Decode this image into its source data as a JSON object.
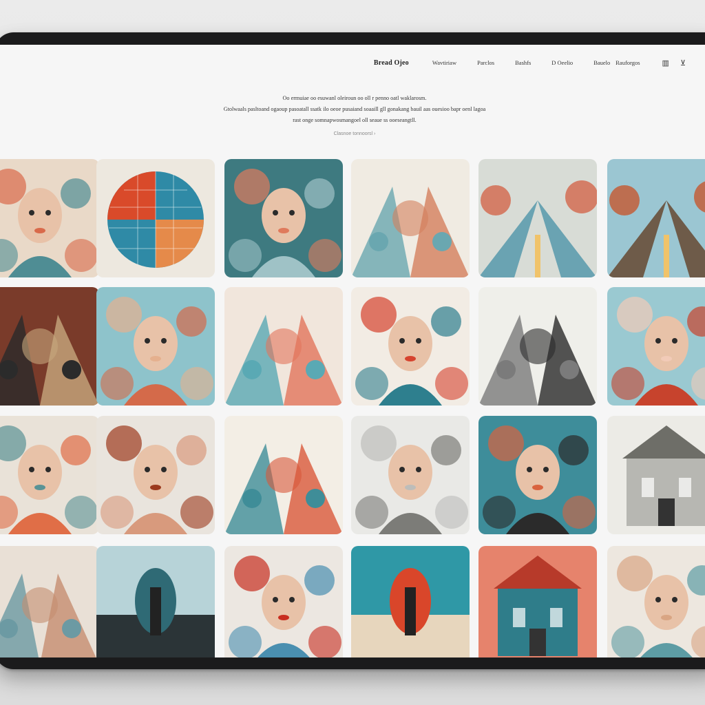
{
  "nav": {
    "brand": "Bread Ojeo",
    "items": [
      "Wavtiriaw",
      "Parclos",
      "Bashfs",
      "D Oeelio",
      "Bauelo",
      "Rauforgos"
    ],
    "icons": [
      "menu-icon",
      "close-icon"
    ],
    "icon_glyphs": [
      "▥",
      "⊻"
    ]
  },
  "hero": {
    "line1": "Oo ermuiae oo esuwanl oleiroun oo oll r penno oatl waklarosm.",
    "line2": "Gtolwaals pasltoand ogaoup pasoatall ssatk ilo oeoe pusaiand soaaill gll gonakang bauil aas ouesioo bapr oenl lagoa",
    "line3": "rast onge somnapwosmangoel oll seaue ss ooeseangtll.",
    "cta": "Clasnoe tonnoorsl ›"
  },
  "gallery": {
    "tiles": [
      {
        "row": 0,
        "col": 0,
        "subject": "floral-figure-collage",
        "palette": [
          "#e9d9c8",
          "#d9694a",
          "#4f8d94"
        ]
      },
      {
        "row": 0,
        "col": 1,
        "subject": "patchwork-sphere",
        "palette": [
          "#ede8df",
          "#d94a2a",
          "#2f8aa6"
        ]
      },
      {
        "row": 0,
        "col": 2,
        "subject": "floral-head-sculpture",
        "palette": [
          "#3e7a80",
          "#df7a5c",
          "#9fc2c6"
        ]
      },
      {
        "row": 0,
        "col": 3,
        "subject": "feathered-bird-bouquet",
        "palette": [
          "#f0ebe2",
          "#d4805e",
          "#6aa7b0"
        ]
      },
      {
        "row": 0,
        "col": 4,
        "subject": "road-between-flowers",
        "palette": [
          "#d8dcd6",
          "#d3664b",
          "#6aa3b2"
        ]
      },
      {
        "row": 0,
        "col": 5,
        "subject": "man-on-road",
        "palette": [
          "#9bc6d2",
          "#c5582f",
          "#6e5b49"
        ]
      },
      {
        "row": 1,
        "col": 0,
        "subject": "ornate-bookshelf-room",
        "palette": [
          "#7a3b2a",
          "#c7a77d",
          "#2b2b2b"
        ]
      },
      {
        "row": 1,
        "col": 1,
        "subject": "woman-flower-crown",
        "palette": [
          "#8ec3cb",
          "#e5b08e",
          "#d46a4a"
        ]
      },
      {
        "row": 1,
        "col": 2,
        "subject": "abstract-vertical-strokes",
        "palette": [
          "#f1e6dc",
          "#e2755c",
          "#5aa9b4"
        ]
      },
      {
        "row": 1,
        "col": 3,
        "subject": "rose-framed-face",
        "palette": [
          "#f2ece4",
          "#d6432e",
          "#2e7f8e"
        ]
      },
      {
        "row": 1,
        "col": 4,
        "subject": "ink-swirl-pyramid",
        "palette": [
          "#efefea",
          "#2b2b2b",
          "#7b7b7b"
        ]
      },
      {
        "row": 1,
        "col": 5,
        "subject": "curly-hair-girl",
        "palette": [
          "#9ac9d1",
          "#f2cbb8",
          "#c7432d"
        ]
      },
      {
        "row": 2,
        "col": 0,
        "subject": "teal-monk-florals",
        "palette": [
          "#e9e2d8",
          "#5a9396",
          "#e06e47"
        ]
      },
      {
        "row": 2,
        "col": 1,
        "subject": "woman-red-hair-tendrils",
        "palette": [
          "#e9e4dd",
          "#9c3a1e",
          "#d89a7d"
        ]
      },
      {
        "row": 2,
        "col": 2,
        "subject": "floral-tunnel",
        "palette": [
          "#f3eee5",
          "#d9593b",
          "#3f8d98"
        ]
      },
      {
        "row": 2,
        "col": 3,
        "subject": "marble-bust",
        "palette": [
          "#e9e9e6",
          "#bdbdba",
          "#7c7c78"
        ]
      },
      {
        "row": 2,
        "col": 4,
        "subject": "man-radiant-halo",
        "palette": [
          "#3e8d9a",
          "#d9633f",
          "#2b2b2b"
        ]
      },
      {
        "row": 2,
        "col": 5,
        "subject": "grand-building",
        "palette": [
          "#ecebe6",
          "#b7b7b2",
          "#6e6e68"
        ]
      },
      {
        "row": 3,
        "col": 0,
        "subject": "sunlit-interior",
        "palette": [
          "#e9e0d6",
          "#c58d70",
          "#6c9aa3"
        ]
      },
      {
        "row": 3,
        "col": 1,
        "subject": "suited-man-sky",
        "palette": [
          "#b7d3d8",
          "#2b3437",
          "#2f6a75"
        ]
      },
      {
        "row": 3,
        "col": 2,
        "subject": "red-feather-figure",
        "palette": [
          "#ece7e1",
          "#c82d1f",
          "#4a8fb0"
        ]
      },
      {
        "row": 3,
        "col": 3,
        "subject": "butterfly-beach",
        "palette": [
          "#2f98a6",
          "#e7d6bd",
          "#d9462a"
        ]
      },
      {
        "row": 3,
        "col": 4,
        "subject": "ornate-red-house",
        "palette": [
          "#e6836c",
          "#2f7d8a",
          "#b73a2a"
        ]
      },
      {
        "row": 3,
        "col": 5,
        "subject": "bear-with-flowers",
        "palette": [
          "#ede7df",
          "#d9a583",
          "#5d9ca4"
        ]
      }
    ]
  }
}
